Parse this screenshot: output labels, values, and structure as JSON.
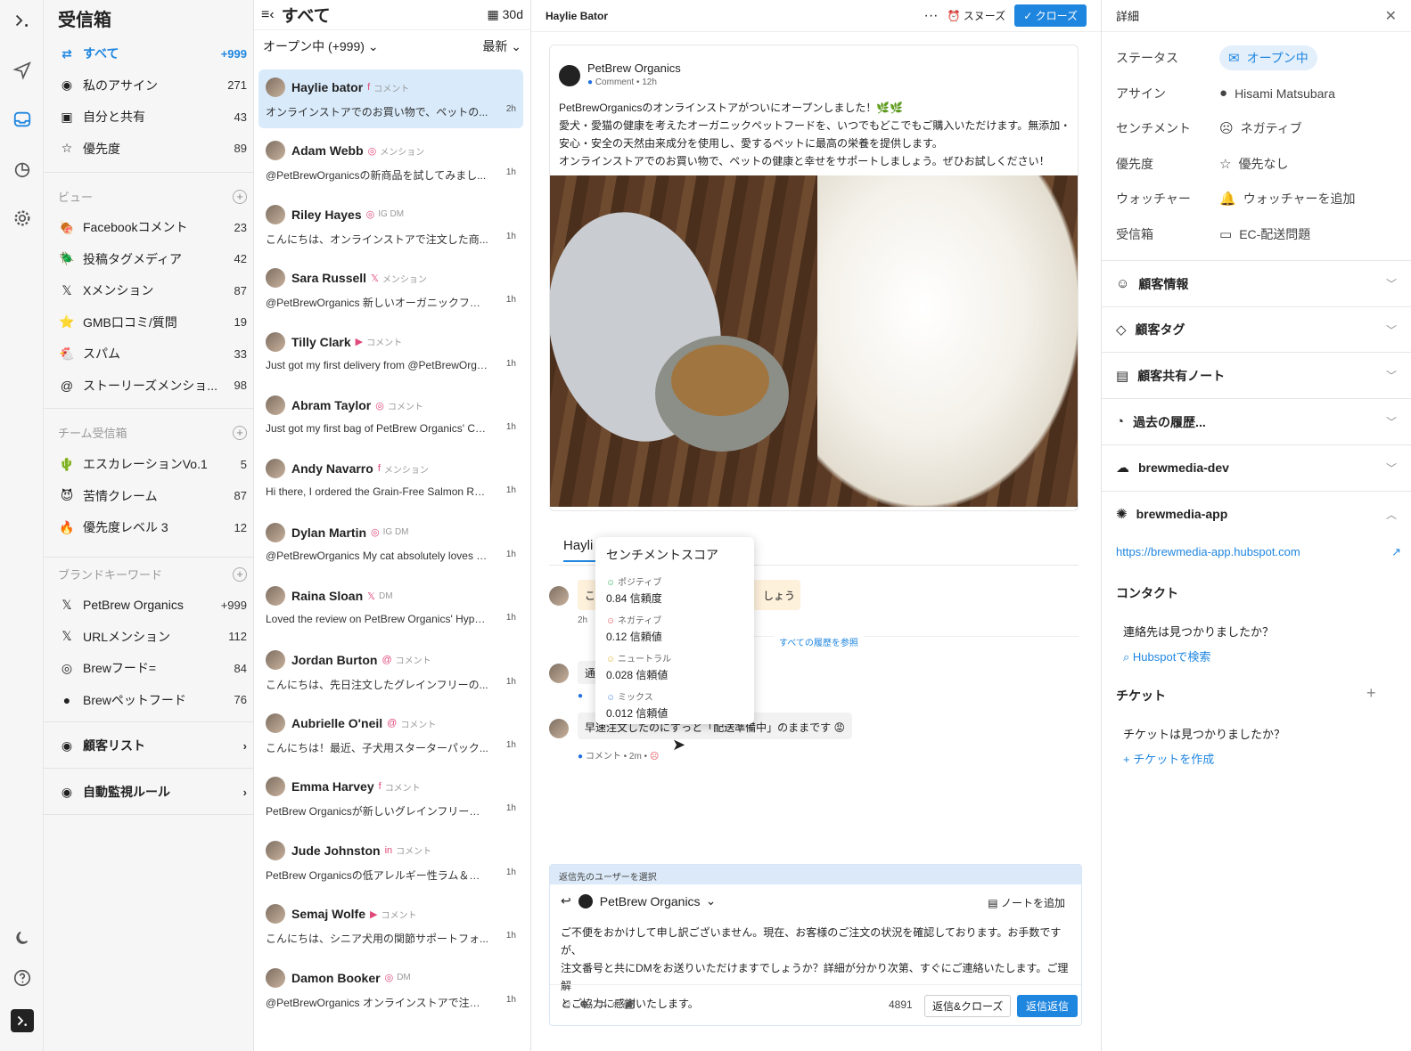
{
  "nav": {
    "title": "受信箱",
    "items": [
      {
        "label": "すべて",
        "count": "+999",
        "icon": "all-icon"
      },
      {
        "label": "私のアサイン",
        "count": "271",
        "icon": "user-icon"
      },
      {
        "label": "自分と共有",
        "count": "43",
        "icon": "shared-icon"
      },
      {
        "label": "優先度",
        "count": "89",
        "icon": "star-icon"
      }
    ],
    "views_header": "ビュー",
    "views": [
      {
        "label": "Facebookコメント",
        "count": "23",
        "emoji": "🍖"
      },
      {
        "label": "投稿タグメディア",
        "count": "42",
        "emoji": "🪲"
      },
      {
        "label": "Xメンション",
        "count": "87",
        "emoji": "𝕏"
      },
      {
        "label": "GMB口コミ/質問",
        "count": "19",
        "emoji": "⭐"
      },
      {
        "label": "スパム",
        "count": "33",
        "emoji": "🐔"
      },
      {
        "label": "ストーリーズメンショ...",
        "count": "98",
        "emoji": "@"
      }
    ],
    "team_header": "チーム受信箱",
    "team": [
      {
        "label": "エスカレーションVo.1",
        "count": "5",
        "emoji": "🌵"
      },
      {
        "label": "苦情クレーム",
        "count": "87",
        "emoji": "😈"
      },
      {
        "label": "優先度レベル 3",
        "count": "12",
        "emoji": "🔥"
      }
    ],
    "brand_header": "ブランドキーワード",
    "brand": [
      {
        "label": "PetBrew Organics",
        "count": "+999",
        "emoji": "𝕏"
      },
      {
        "label": "URLメンション",
        "count": "112",
        "emoji": "𝕏"
      },
      {
        "label": "Brewフード=",
        "count": "84",
        "emoji": "◎"
      },
      {
        "label": "Brewペットフード",
        "count": "76",
        "emoji": "●"
      }
    ],
    "customer_list": "顧客リスト",
    "auto_rules": "自動監視ルール"
  },
  "list": {
    "title": "すべて",
    "range": "30d",
    "filter": "オープン中 (+999)",
    "sort": "最新",
    "items": [
      {
        "name": "Haylie bator",
        "channel": "f",
        "type": "コメント",
        "text": "オンラインストアでのお買い物で、ペットの...",
        "time": "2h"
      },
      {
        "name": "Adam Webb",
        "channel": "◎",
        "type": "メンション",
        "text": "@PetBrewOrganicsの新商品を試してみまし...",
        "time": "1h"
      },
      {
        "name": "Riley Hayes",
        "channel": "◎",
        "type": "IG DM",
        "text": "こんにちは、オンラインストアで注文した商...",
        "time": "1h"
      },
      {
        "name": "Sara Russell",
        "channel": "𝕏",
        "type": "メンション",
        "text": "@PetBrewOrganics 新しいオーガニックフー...",
        "time": "1h"
      },
      {
        "name": "Tilly Clark",
        "channel": "▶",
        "type": "コメント",
        "text": "Just got my first delivery from @PetBrewOrga...",
        "time": "1h"
      },
      {
        "name": "Abram Taylor",
        "channel": "◎",
        "type": "コメント",
        "text": "Just got my first bag of PetBrew Organics' Chi...",
        "time": "1h"
      },
      {
        "name": "Andy Navarro",
        "channel": "f",
        "type": "メンション",
        "text": "Hi there, I ordered the Grain-Free Salmon Reci...",
        "time": "1h"
      },
      {
        "name": "Dylan Martin",
        "channel": "◎",
        "type": "IG DM",
        "text": "@PetBrewOrganics My cat absolutely loves th...",
        "time": "1h"
      },
      {
        "name": "Raina Sloan",
        "channel": "𝕏",
        "type": "DM",
        "text": "Loved the review on PetBrew Organics' Hypoa...",
        "time": "1h"
      },
      {
        "name": "Jordan Burton",
        "channel": "@",
        "type": "コメント",
        "text": "こんにちは、先日注文したグレインフリーの...",
        "time": "1h"
      },
      {
        "name": "Aubrielle O'neil",
        "channel": "@",
        "type": "コメント",
        "text": "こんにちは！最近、子犬用スターターパック...",
        "time": "1h"
      },
      {
        "name": "Emma Harvey",
        "channel": "f",
        "type": "コメント",
        "text": "PetBrew Organicsが新しいグレインフリーの...",
        "time": "1h"
      },
      {
        "name": "Jude Johnston",
        "channel": "in",
        "type": "コメント",
        "text": "PetBrew Organicsの低アレルギー性ラム＆ラ...",
        "time": "1h"
      },
      {
        "name": "Semaj Wolfe",
        "channel": "▶",
        "type": "コメント",
        "text": "こんにちは、シニア犬用の関節サポートフォ...",
        "time": "1h"
      },
      {
        "name": "Damon Booker",
        "channel": "◎",
        "type": "DM",
        "text": "@PetBrewOrganics オンラインストアで注文...",
        "time": "1h"
      }
    ]
  },
  "conv": {
    "header_name": "Haylie Bator",
    "snooze": "スヌーズ",
    "close": "クローズ",
    "post": {
      "author": "PetBrew Organics",
      "meta": "Comment • 12h",
      "lines": [
        "PetBrewOrganicsのオンラインストアがついにオープンしました！🌿🌿",
        "愛犬・愛猫の健康を考えたオーガニックペットフードを、いつでもどこでもご購入いただけます。無添加・",
        "安心・安全の天然由来成分を使用し、愛するペットに最高の栄養を提供します。",
        "オンラインストアでのお買い物で、ペットの健康と幸せをサポートしましょう。ぜひお試しください！"
      ]
    },
    "tab": "Hayli",
    "msg1_start": "こ",
    "msg1_end": "しょう",
    "msg1_time": "2h",
    "history_link": "すべての履歴を参照",
    "msg2_start": "通",
    "msg3": "早速注文したのにずっと「配送準備中」のままです 😡",
    "msg3_meta": "コメント • 2m •",
    "popup": {
      "title": "センチメントスコア",
      "rows": [
        {
          "label": "ポジティブ",
          "value": "0.84 信頼度",
          "color": "#3bb56b"
        },
        {
          "label": "ネガティブ",
          "value": "0.12 信頼値",
          "color": "#e0505a"
        },
        {
          "label": "ニュートラル",
          "value": "0.028 信頼値",
          "color": "#e5b93a"
        },
        {
          "label": "ミックス",
          "value": "0.012 信頼値",
          "color": "#5b8ee0"
        }
      ]
    },
    "reply": {
      "bar": "返信先のユーザーを選択",
      "account": "PetBrew Organics",
      "note": "ノートを追加",
      "lines": [
        "ご不便をおかけして申し訳ございません。現在、お客様のご注文の状況を確認しております。お手数ですが、",
        "注文番号と共にDMをお送りいただけますでしょうか？詳細が分かり次第、すぐにご連絡いたします。ご理解",
        "とご協力に感謝いたします。"
      ],
      "count": "4891",
      "reply_close": "返信&クローズ",
      "send": "返信返信"
    }
  },
  "details": {
    "title": "詳細",
    "rows": [
      {
        "k": "ステータス",
        "v": "オープン中",
        "icon": "✉"
      },
      {
        "k": "アサイン",
        "v": "Hisami Matsubara",
        "icon": "●"
      },
      {
        "k": "センチメント",
        "v": "ネガティブ",
        "icon": "☹"
      },
      {
        "k": "優先度",
        "v": "優先なし",
        "icon": "☆"
      },
      {
        "k": "ウォッチャー",
        "v": "ウォッチャーを追加",
        "icon": "🔔"
      },
      {
        "k": "受信箱",
        "v": "EC-配送問題",
        "icon": "▭"
      }
    ],
    "accordions": [
      {
        "label": "顧客情報",
        "icon": "☺"
      },
      {
        "label": "顧客タグ",
        "icon": "◇"
      },
      {
        "label": "顧客共有ノート",
        "icon": "▤"
      },
      {
        "label": "過去の履歴...",
        "icon": "◔"
      },
      {
        "label": "brewmedia-dev",
        "icon": "☁"
      },
      {
        "label": "brewmedia-app",
        "icon": "✺"
      }
    ],
    "hubspot_url": "https://brewmedia-app.hubspot.com",
    "contact_title": "コンタクト",
    "contact_q": "連絡先は見つかりましたか？",
    "contact_search": "Hubspotで検索",
    "ticket_title": "チケット",
    "ticket_q": "チケットは見つかりましたか？",
    "ticket_create": "チケットを作成"
  }
}
